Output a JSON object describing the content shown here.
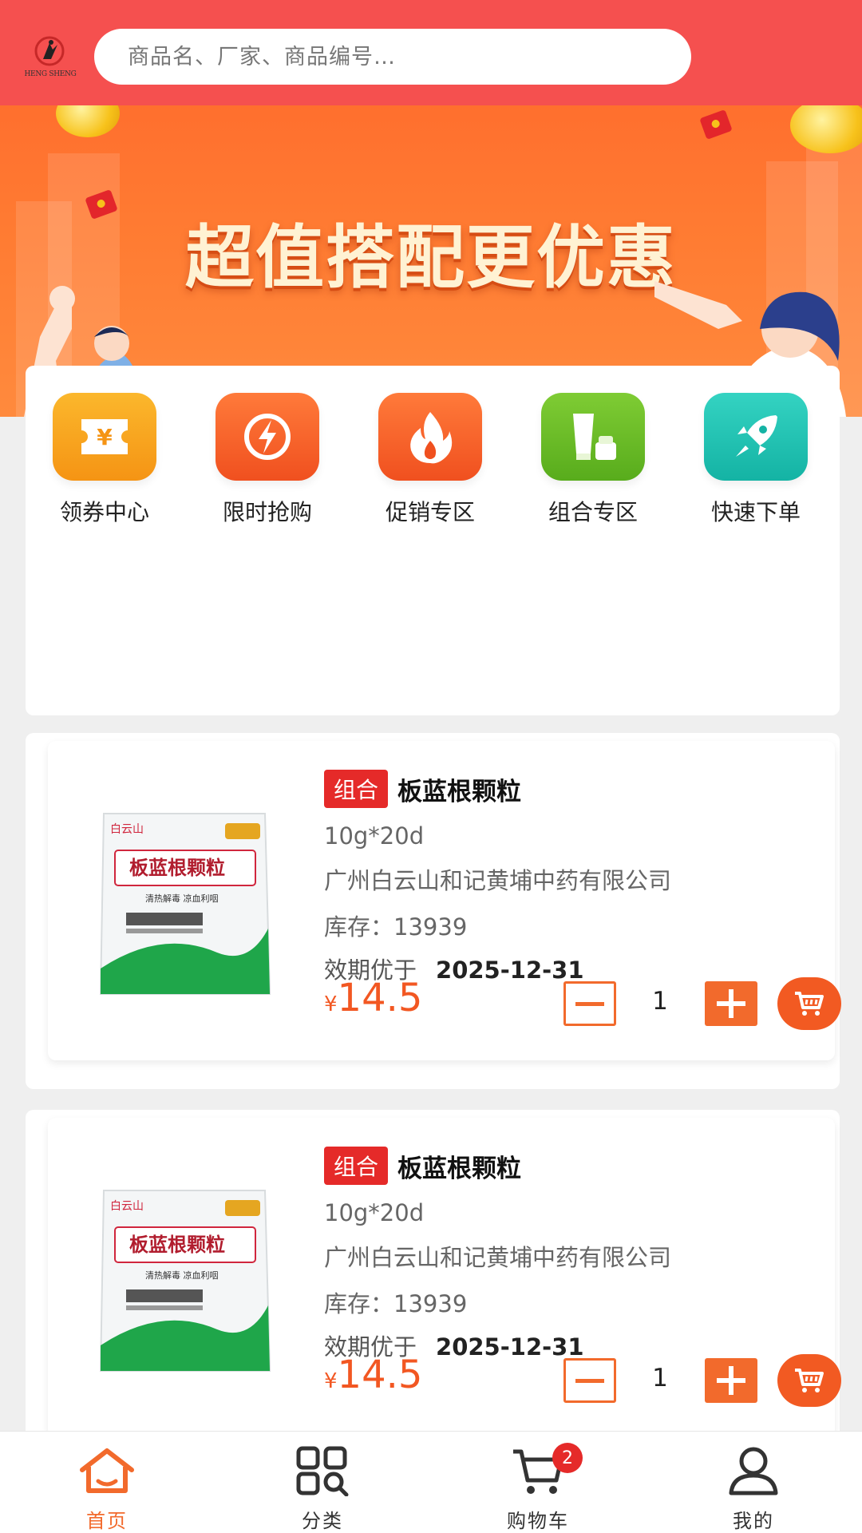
{
  "header": {
    "logo_text": "HENG SHENG",
    "search_placeholder": "商品名、厂家、商品编号…"
  },
  "banner": {
    "title": "超值搭配更优惠",
    "slide_count": 4,
    "active_slide": 4
  },
  "menu": [
    {
      "label": "领券中心",
      "icon": "coupon-icon",
      "color": "#f7a21b"
    },
    {
      "label": "限时抢购",
      "icon": "lightning-icon",
      "color": "#f4612a"
    },
    {
      "label": "促销专区",
      "icon": "flame-icon",
      "color": "#f4612a"
    },
    {
      "label": "组合专区",
      "icon": "products-icon",
      "color": "#6cc02a"
    },
    {
      "label": "快速下单",
      "icon": "rocket-icon",
      "color": "#22c4b4"
    }
  ],
  "products": [
    {
      "tag": "组合",
      "name": "板蓝根颗粒",
      "spec": "10g*20d",
      "manufacturer": "广州白云山和记黄埔中药有限公司",
      "stock_label": "库存：",
      "stock": "13939",
      "expiry_label": "效期优于",
      "expiry": "2025-12-31",
      "currency": "¥",
      "price": "14.5",
      "quantity": "1",
      "pack_brand": "白云山",
      "pack_title": "板蓝根颗粒",
      "pack_sub": "清热解毒 凉血利咽"
    },
    {
      "tag": "组合",
      "name": "板蓝根颗粒",
      "spec": "10g*20d",
      "manufacturer": "广州白云山和记黄埔中药有限公司",
      "stock_label": "库存：",
      "stock": "13939",
      "expiry_label": "效期优于",
      "expiry": "2025-12-31",
      "currency": "¥",
      "price": "14.5",
      "quantity": "1",
      "pack_brand": "白云山",
      "pack_title": "板蓝根颗粒",
      "pack_sub": "清热解毒 凉血利咽"
    }
  ],
  "tabbar": {
    "items": [
      {
        "label": "首页",
        "icon": "home-icon",
        "active": true
      },
      {
        "label": "分类",
        "icon": "category-icon",
        "active": false
      },
      {
        "label": "购物车",
        "icon": "cart-icon",
        "active": false,
        "badge": "2"
      },
      {
        "label": "我的",
        "icon": "user-icon",
        "active": false
      }
    ]
  },
  "colors": {
    "header": "#f5504f",
    "accent": "#f26a2c",
    "tag": "#e52a29"
  }
}
